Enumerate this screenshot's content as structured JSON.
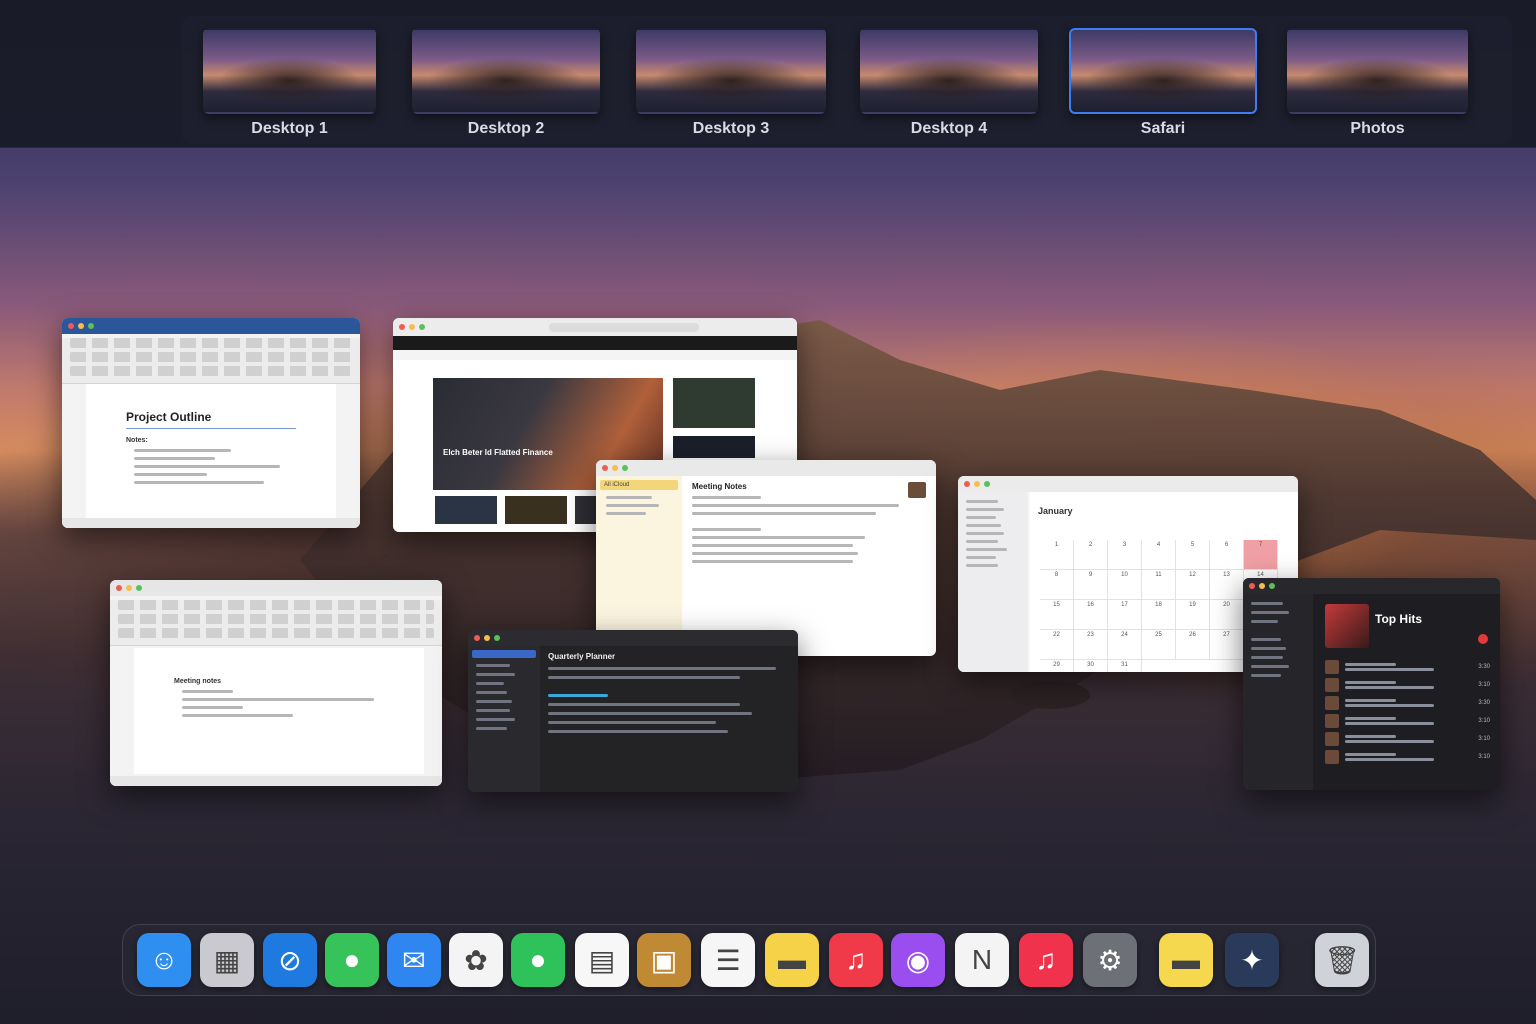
{
  "spaces": [
    {
      "label": "Desktop 1",
      "active": false
    },
    {
      "label": "Desktop 2",
      "active": false
    },
    {
      "label": "Desktop 3",
      "active": false
    },
    {
      "label": "Desktop 4",
      "active": false
    },
    {
      "label": "Safari",
      "active": true
    },
    {
      "label": "Photos",
      "active": false
    }
  ],
  "windows": {
    "word_doc": {
      "title": "Project Outline",
      "subheading": "Notes:"
    },
    "notes": {
      "title": "Meeting Notes",
      "sidebar_item": "All iCloud"
    },
    "calendar": {
      "month": "January",
      "days": [
        "1",
        "2",
        "3",
        "4",
        "5",
        "6",
        "7",
        "8",
        "9",
        "10",
        "11",
        "12",
        "13",
        "14",
        "15",
        "16",
        "17",
        "18",
        "19",
        "20",
        "21",
        "22",
        "23",
        "24",
        "25",
        "26",
        "27",
        "28",
        "29",
        "30",
        "31"
      ]
    },
    "reminders": {
      "title": "Quarterly Planner"
    },
    "music": {
      "title": "Top Hits",
      "durations": [
        "3:30",
        "3:10",
        "3:30",
        "3:10",
        "3:10",
        "3:10"
      ]
    },
    "safari": {
      "headline": "Elch Beter ld Flatted Finance"
    },
    "word_doc2": {
      "title": "Meeting notes"
    }
  },
  "dock": [
    {
      "name": "finder-icon",
      "glyph": "☺",
      "bg": "#2f8ff0"
    },
    {
      "name": "launchpad-icon",
      "glyph": "▦",
      "bg": "#c9c9cf"
    },
    {
      "name": "safari-icon",
      "glyph": "⊘",
      "bg": "#1f7ae0"
    },
    {
      "name": "messages-icon",
      "glyph": "●",
      "bg": "#35c35a"
    },
    {
      "name": "mail-icon",
      "glyph": "✉",
      "bg": "#2f86f0"
    },
    {
      "name": "photos-icon",
      "glyph": "✿",
      "bg": "#f4f4f4"
    },
    {
      "name": "facetime-icon",
      "glyph": "●",
      "bg": "#2fc15a"
    },
    {
      "name": "calendar-icon",
      "glyph": "▤",
      "bg": "#f7f7f7"
    },
    {
      "name": "preview-icon",
      "glyph": "▣",
      "bg": "#c08a34"
    },
    {
      "name": "reminders-icon",
      "glyph": "☰",
      "bg": "#f6f6f6"
    },
    {
      "name": "notes-icon",
      "glyph": "▬",
      "bg": "#f5d248"
    },
    {
      "name": "music-icon",
      "glyph": "♫",
      "bg": "#f03a4a"
    },
    {
      "name": "podcasts-icon",
      "glyph": "◉",
      "bg": "#9a4ef0"
    },
    {
      "name": "news-icon",
      "glyph": "N",
      "bg": "#f4f4f4"
    },
    {
      "name": "itunes-icon",
      "glyph": "♫",
      "bg": "#f0324c"
    },
    {
      "name": "system-preferences-icon",
      "glyph": "⚙",
      "bg": "#6e7078"
    },
    {
      "name": "stickies-icon",
      "glyph": "▬",
      "bg": "#f6d84e"
    },
    {
      "name": "screenshot-icon",
      "glyph": "✦",
      "bg": "#2a3a5a"
    },
    {
      "name": "trash-icon",
      "glyph": "🗑",
      "bg": "#cfd2d8"
    }
  ]
}
